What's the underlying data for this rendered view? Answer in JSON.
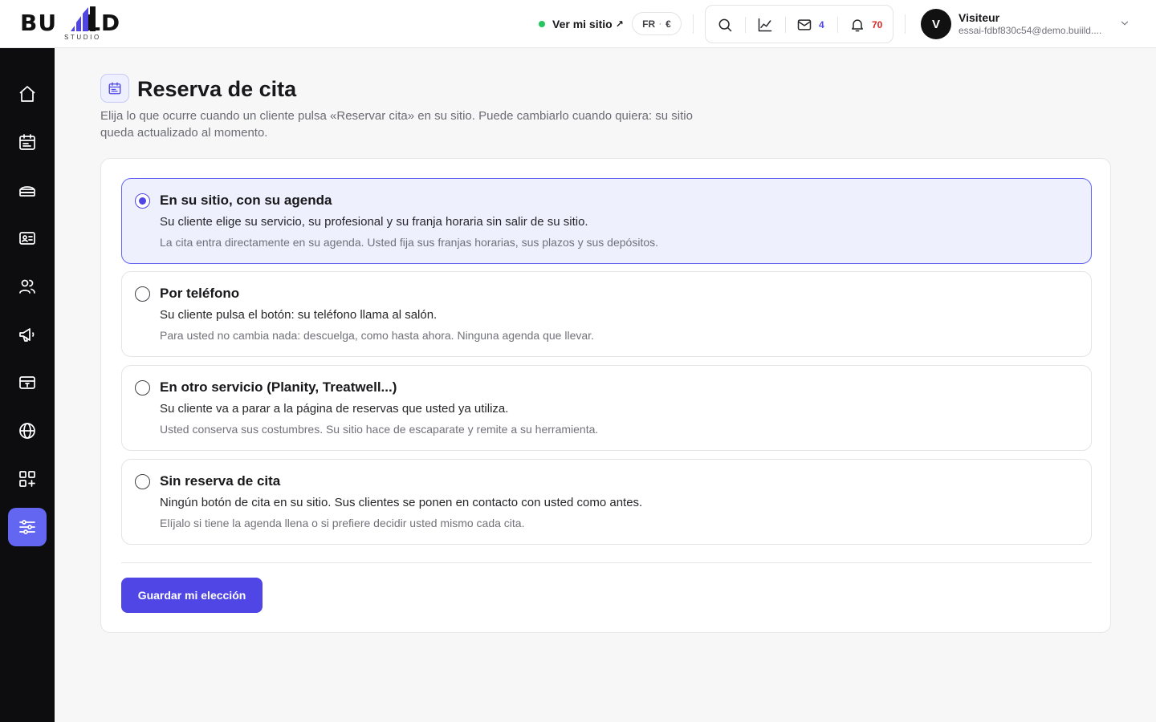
{
  "brand": {
    "logo_left": "BU",
    "logo_right": "LD",
    "logo_sub": "STUDIO",
    "accent": "#4f46e5",
    "sidebar_bg": "#0d0d0f"
  },
  "header": {
    "site_link_label": "Ver mi sitio",
    "site_link_arrow": "↗",
    "site_status_color": "#22c55e",
    "lang": "FR",
    "lang_sep": "·",
    "currency": "€",
    "icons": [
      "search-icon",
      "chart-icon",
      "mail-icon",
      "bell-icon"
    ],
    "mail_count": "4",
    "notification_count": "70"
  },
  "user": {
    "initial": "V",
    "name": "Visiteur",
    "email": "essai-fdbf830c54@demo.buiild...."
  },
  "sidebar": {
    "items": [
      {
        "icon": "home-icon"
      },
      {
        "icon": "calendar-icon"
      },
      {
        "icon": "services-icon"
      },
      {
        "icon": "contact-card-icon"
      },
      {
        "icon": "users-icon"
      },
      {
        "icon": "megaphone-icon"
      },
      {
        "icon": "payment-icon"
      },
      {
        "icon": "globe-icon"
      },
      {
        "icon": "apps-icon"
      },
      {
        "icon": "settings-sliders-icon",
        "active": true
      }
    ]
  },
  "page": {
    "title": "Reserva de cita",
    "description": "Elija lo que ocurre cuando un cliente pulsa «Reservar cita» en su sitio. Puede cambiarlo cuando quiera: su sitio queda actualizado al momento."
  },
  "options": [
    {
      "title": "En su sitio, con su agenda",
      "line1": "Su cliente elige su servicio, su profesional y su franja horaria sin salir de su sitio.",
      "line2": "La cita entra directamente en su agenda. Usted fija sus franjas horarias, sus plazos y sus depósitos.",
      "selected": true
    },
    {
      "title": "Por teléfono",
      "line1": "Su cliente pulsa el botón: su teléfono llama al salón.",
      "line2": "Para usted no cambia nada: descuelga, como hasta ahora. Ninguna agenda que llevar.",
      "selected": false
    },
    {
      "title": "En otro servicio (Planity, Treatwell...)",
      "line1": "Su cliente va a parar a la página de reservas que usted ya utiliza.",
      "line2": "Usted conserva sus costumbres. Su sitio hace de escaparate y remite a su herramienta.",
      "selected": false
    },
    {
      "title": "Sin reserva de cita",
      "line1": "Ningún botón de cita en su sitio. Sus clientes se ponen en contacto con usted como antes.",
      "line2": "Elíjalo si tiene la agenda llena o si prefiere decidir usted mismo cada cita.",
      "selected": false
    }
  ],
  "actions": {
    "save_label": "Guardar mi elección"
  }
}
